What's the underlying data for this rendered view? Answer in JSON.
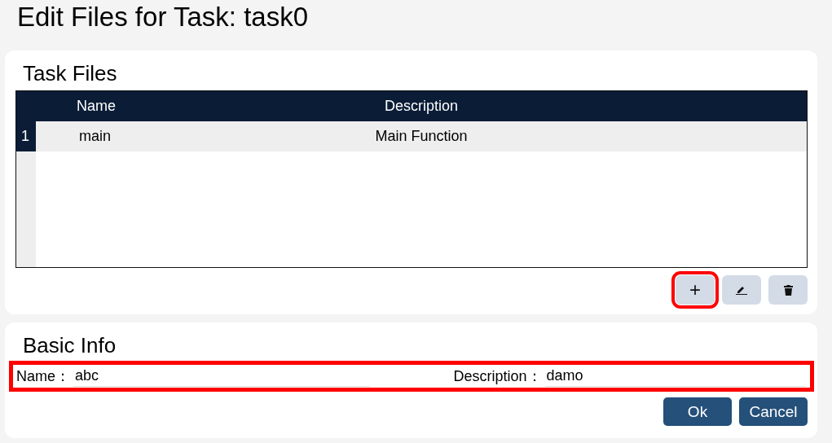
{
  "title": "Edit Files for Task: task0",
  "task_files": {
    "heading": "Task Files",
    "columns": [
      "Name",
      "Description"
    ],
    "rows": [
      {
        "index": "1",
        "name": "main",
        "description": "Main Function",
        "selected": false
      }
    ],
    "buttons": [
      {
        "kind": "add",
        "label": "+",
        "highlighted": true
      },
      {
        "kind": "edit",
        "highlighted": false
      },
      {
        "kind": "delete",
        "highlighted": false
      }
    ]
  },
  "basic_info": {
    "heading": "Basic Info",
    "highlighted": true,
    "fields": [
      {
        "label": "Name：",
        "value": "abc"
      },
      {
        "label": "Description：",
        "value": "damo"
      }
    ],
    "buttons": [
      "Ok",
      "Cancel"
    ]
  }
}
